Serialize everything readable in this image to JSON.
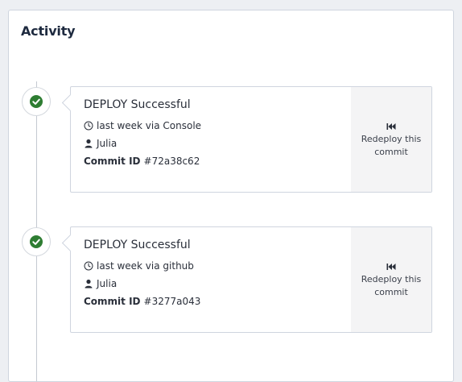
{
  "panel": {
    "title": "Activity"
  },
  "activity": [
    {
      "title": "DEPLOY Successful",
      "time_source": "last week via Console",
      "user": "Julia",
      "commit_label": "Commit ID",
      "commit_id": "#72a38c62",
      "action_label": "Redeploy this commit"
    },
    {
      "title": "DEPLOY Successful",
      "time_source": "last week via github",
      "user": "Julia",
      "commit_label": "Commit ID",
      "commit_id": "#3277a043",
      "action_label": "Redeploy this commit"
    }
  ],
  "icons": {
    "status": "check-circle-icon",
    "time": "clock-icon",
    "user": "user-icon",
    "action": "rewind-icon"
  },
  "colors": {
    "success": "#2e7d32",
    "title": "#1e2a3f",
    "action_bg": "#f4f4f5",
    "border": "#cfd5df"
  }
}
